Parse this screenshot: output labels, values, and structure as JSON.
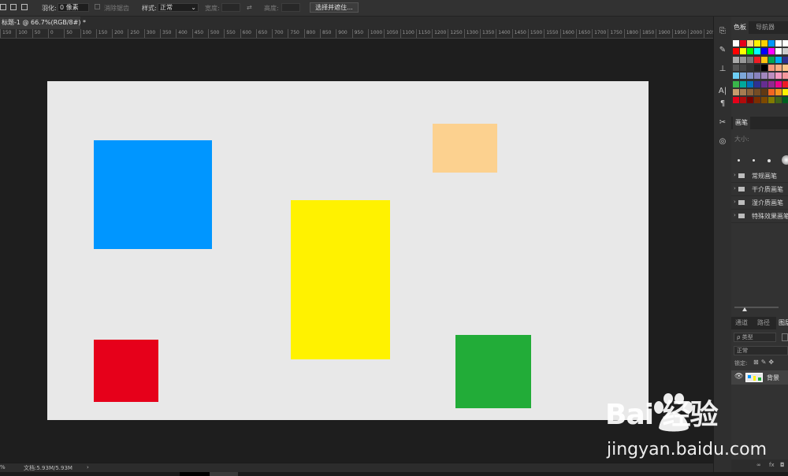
{
  "options_bar": {
    "feather_label": "羽化:",
    "feather_value": "0 像素",
    "antialias_label": "消除锯齿",
    "style_label": "样式:",
    "style_value": "正常",
    "width_label": "宽度:",
    "height_label": "高度:",
    "select_mask_button": "选择并遮住..."
  },
  "document": {
    "tab_title": "标题-1 @ 66.7%(RGB/8#) *"
  },
  "ruler": {
    "ticks": [
      "150",
      "100",
      "50",
      "0",
      "50",
      "100",
      "150",
      "200",
      "250",
      "300",
      "350",
      "400",
      "450",
      "500",
      "550",
      "600",
      "650",
      "700",
      "750",
      "800",
      "850",
      "900",
      "950",
      "1000",
      "1050",
      "1100",
      "1150",
      "1200",
      "1250",
      "1300",
      "1350",
      "1400",
      "1450",
      "1500",
      "1550",
      "1600",
      "1650",
      "1700",
      "1750",
      "1800",
      "1850",
      "1900",
      "1950",
      "2000",
      "2050"
    ]
  },
  "canvas": {
    "background": "#e8e8e8",
    "shapes": [
      {
        "name": "blue-rectangle",
        "color": "#0096ff"
      },
      {
        "name": "orange-rectangle",
        "color": "#fcd18f"
      },
      {
        "name": "yellow-rectangle",
        "color": "#fff200"
      },
      {
        "name": "red-rectangle",
        "color": "#e6001a"
      },
      {
        "name": "green-rectangle",
        "color": "#22ac38"
      }
    ]
  },
  "status": {
    "zoom": "%",
    "doc_info": "文档:5.93M/5.93M",
    "arrow": "›"
  },
  "panels": {
    "swatches_tab": "色板",
    "navigator_tab": "导航器",
    "brush_tab": "画笔",
    "brush_size_label": "大小:",
    "brush_folders": [
      "常规画笔",
      "干介质画笔",
      "湿介质画笔",
      "特殊效果画笔"
    ],
    "channels_tab": "通道",
    "paths_tab": "路径",
    "layers_tab": "图层",
    "layer_filter": "ρ 类型",
    "blend_mode": "正常",
    "lock_label": "锁定:",
    "layer_name": "背景"
  },
  "watermark": {
    "logo": "Bai 经验",
    "url": "jingyan.baidu.com"
  }
}
